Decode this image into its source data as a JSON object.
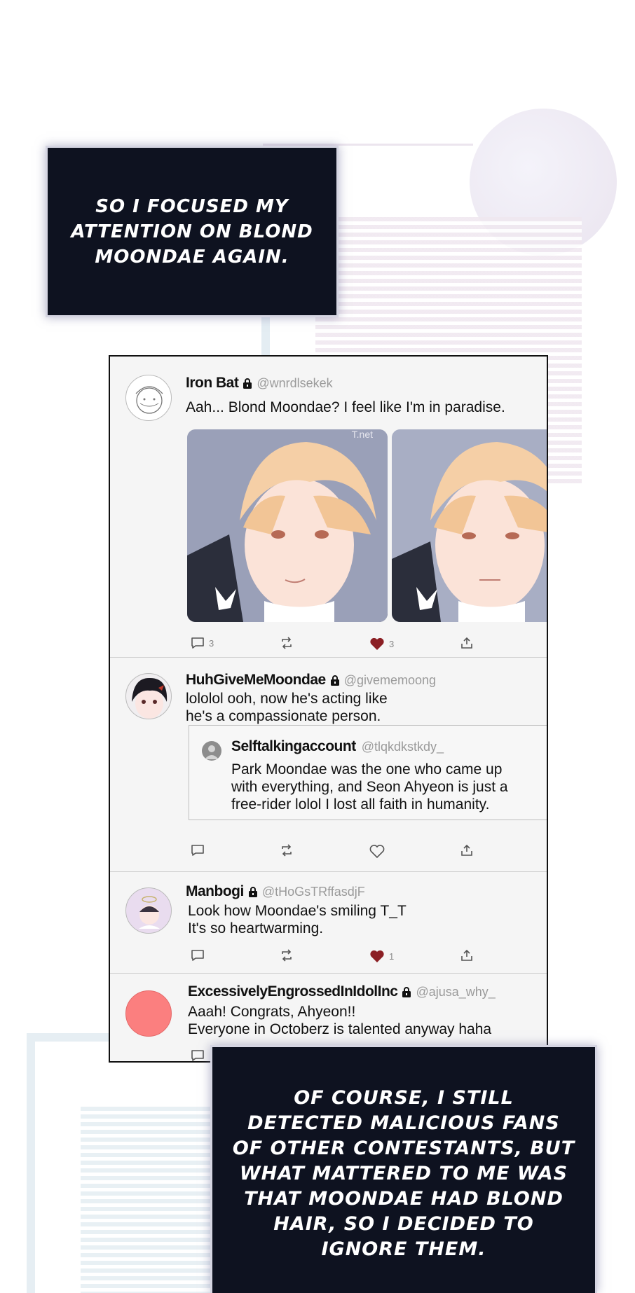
{
  "captions": {
    "top": "SO I FOCUSED MY\nATTENTION ON BLOND\nMOONDAE AGAIN.",
    "bottom": "OF COURSE, I STILL\nDETECTED MALICIOUS FANS\nOF OTHER CONTESTANTS, BUT\nWHAT MATTERED TO ME WAS\nTHAT MOONDAE HAD BLOND\nHAIR, SO I DECIDED TO\nIGNORE THEM."
  },
  "posts": [
    {
      "username": "Iron Bat",
      "handle": "@wnrdlsekek",
      "text": "Aah... Blond Moondae? I feel like I'm in paradise.",
      "image_watermark": "T.net",
      "reply_count": "3",
      "like_count": "3",
      "liked": true
    },
    {
      "username": "HuhGiveMeMoondae",
      "handle": "@givememoong",
      "text": "lololol ooh, now he's acting like\nhe's a compassionate person.",
      "quote": {
        "username": "Selftalkingaccount",
        "handle": "@tlqkdkstkdy_",
        "text": "Park Moondae was the one who came up\nwith everything, and Seon Ahyeon is just a\nfree-rider lolol I lost all faith in humanity."
      },
      "liked": false
    },
    {
      "username": "Manbogi",
      "handle": "@tHoGsTRffasdjF",
      "text": "Look how Moondae's smiling T_T\nIt's so heartwarming.",
      "like_count": "1",
      "liked": true
    },
    {
      "username": "ExcessivelyEngrossedInIdolInc",
      "handle": "@ajusa_why_",
      "text": "Aaah! Congrats,  Ahyeon!!\nEveryone in Octoberz is talented anyway haha"
    }
  ],
  "colors": {
    "caption_bg": "#0e1220",
    "like_red": "#8b1f24",
    "avatar_coral": "#fb7f7f"
  },
  "icons": [
    "reply-icon",
    "repost-icon",
    "heart-icon",
    "share-icon",
    "lock-icon"
  ]
}
